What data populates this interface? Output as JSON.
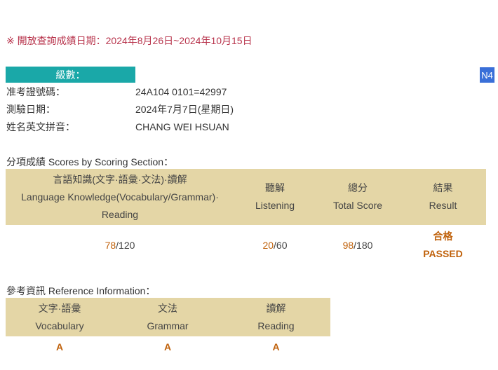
{
  "notice": "※ 開放查詢成績日期：2024年8月26日~2024年10月15日",
  "level": {
    "label": "級數：",
    "value": "N4"
  },
  "info": [
    {
      "label": "准考證號碼：",
      "value": "24A104 0101=42997"
    },
    {
      "label": "測驗日期：",
      "value": "2024年7月7日(星期日)"
    },
    {
      "label": "姓名英文拼音：",
      "value": "CHANG WEI HSUAN"
    }
  ],
  "scores": {
    "title": "分項成績 Scores by Scoring Section：",
    "headers": [
      {
        "zh": "言語知識(文字·語彙·文法)·讀解",
        "en": "Language Knowledge(Vocabulary/Grammar)·",
        "en2": "Reading"
      },
      {
        "zh": "聽解",
        "en": "Listening"
      },
      {
        "zh": "總分",
        "en": "Total Score"
      },
      {
        "zh": "結果",
        "en": "Result"
      }
    ],
    "values": [
      {
        "score": "78",
        "max": "/120"
      },
      {
        "score": "20",
        "max": "/60"
      },
      {
        "score": "98",
        "max": "/180"
      }
    ],
    "result": {
      "zh": "合格",
      "en": "PASSED"
    }
  },
  "reference": {
    "title": "參考資訊 Reference Information：",
    "headers": [
      {
        "zh": "文字·語彙",
        "en": "Vocabulary"
      },
      {
        "zh": "文法",
        "en": "Grammar"
      },
      {
        "zh": "讀解",
        "en": "Reading"
      }
    ],
    "grades": [
      "A",
      "A",
      "A"
    ]
  }
}
